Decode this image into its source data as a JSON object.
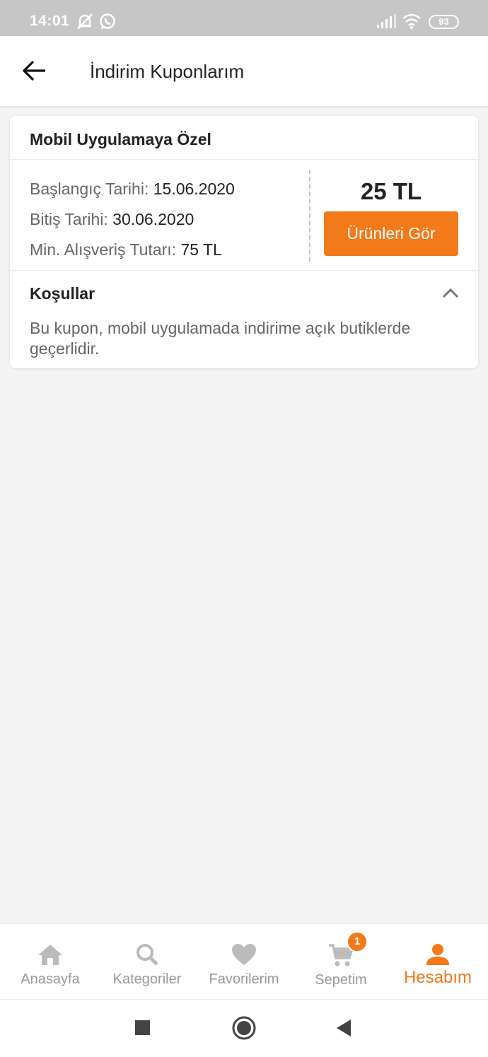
{
  "status_bar": {
    "time": "14:01",
    "battery": "93",
    "icons": [
      "mute-alarm-icon",
      "whatsapp-icon",
      "signal-icon",
      "wifi-icon",
      "battery-icon"
    ]
  },
  "header": {
    "title": "İndirim Kuponlarım",
    "back_icon": "arrow-left-icon"
  },
  "coupon": {
    "title": "Mobil Uygulamaya Özel",
    "start_label": "Başlangıç Tarihi:",
    "start_date": "15.06.2020",
    "end_label": "Bitiş Tarihi:",
    "end_date": "30.06.2020",
    "min_label": "Min. Alışveriş Tutarı:",
    "min_amount": "75 TL",
    "amount": "25 TL",
    "button_label": "Ürünleri Gör",
    "conditions_label": "Koşullar",
    "conditions_text": "Bu kupon, mobil uygulamada indirime açık butiklerde geçerlidir."
  },
  "bottom_nav": {
    "items": [
      {
        "label": "Anasayfa",
        "icon": "home-icon"
      },
      {
        "label": "Kategoriler",
        "icon": "search-icon"
      },
      {
        "label": "Favorilerim",
        "icon": "heart-icon"
      },
      {
        "label": "Sepetim",
        "icon": "cart-icon",
        "badge": "1"
      },
      {
        "label": "Hesabım",
        "icon": "person-icon",
        "active": true
      }
    ]
  },
  "colors": {
    "accent": "#f27a1a",
    "background": "#f4f4f4",
    "status_bar": "#c6c6c6",
    "inactive": "#bbbbbb"
  }
}
